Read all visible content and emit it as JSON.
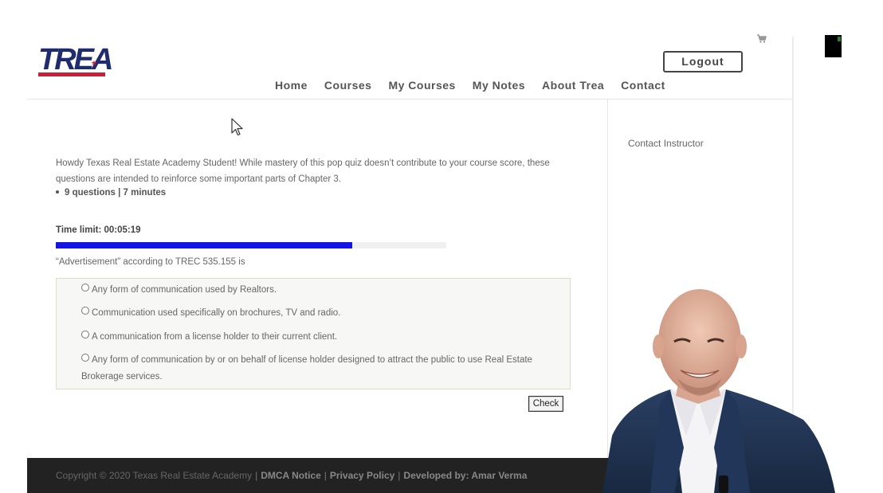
{
  "header": {
    "logo_text": "TREA",
    "logout_label": "Logout",
    "nav": [
      "Home",
      "Courses",
      "My Courses",
      "My Notes",
      "About Trea",
      "Contact"
    ]
  },
  "sidebar": {
    "contact_instructor": "Contact Instructor"
  },
  "quiz": {
    "intro": "Howdy Texas Real Estate Academy Student! While mastery of this pop quiz doesn’t contribute to your course score, these questions are intended to reinforce some important parts of Chapter 3.",
    "meta": "9 questions | 7 minutes",
    "time_limit_label": "Time limit: 00:05:19",
    "time_progress_fraction": 0.76,
    "question": "“Advertisement” according to TREC 535.155 is",
    "answers": [
      "Any form of communication used by Realtors.",
      "Communication used specifically on brochures, TV and radio.",
      "A communication from a license holder to their current client.",
      "Any form of communication by or on behalf of license holder designed to attract the public to use Real Estate Brokerage services."
    ],
    "check_label": "Check"
  },
  "footer": {
    "copyright": "Copyright © 2020 Texas Real Estate Academy",
    "dmca": "DMCA Notice",
    "privacy": "Privacy Policy",
    "developed": "Developed by: Amar Verma",
    "separator": "|"
  },
  "colors": {
    "progress": "#1414e6",
    "logo_blue": "#1e2b6e",
    "logo_red": "#c8203a",
    "footer_bg": "#222222"
  }
}
